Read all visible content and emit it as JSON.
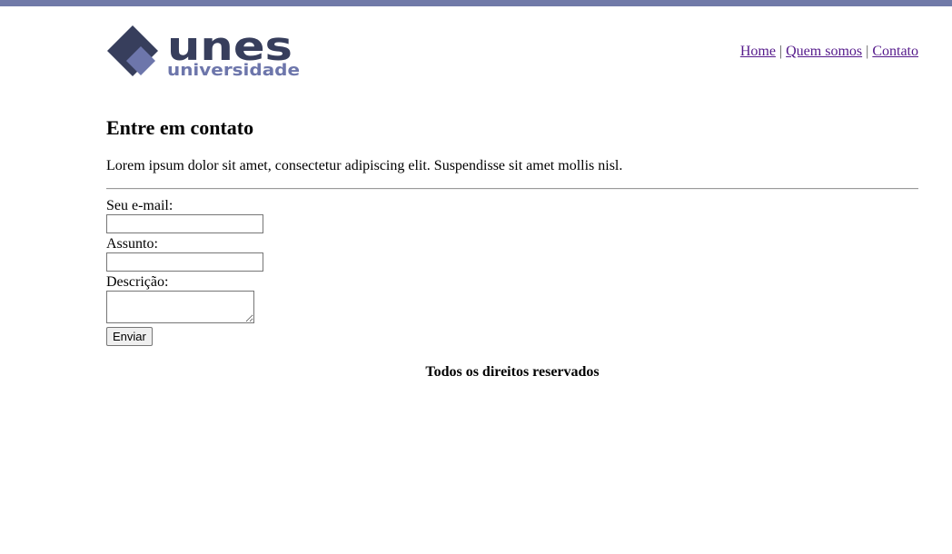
{
  "colors": {
    "top_bar": "#717aa8",
    "logo_dark": "#373e5c",
    "logo_light": "#6d76ab",
    "link": "#551a8b"
  },
  "logo": {
    "wordmark": "unes",
    "subtext": "universidade",
    "icon": "diamond-logo-icon"
  },
  "nav": {
    "items": [
      {
        "label": "Home"
      },
      {
        "label": "Quem somos"
      },
      {
        "label": "Contato"
      }
    ],
    "separator": "|"
  },
  "content": {
    "title": "Entre em contato",
    "intro": "Lorem ipsum dolor sit amet, consectetur adipiscing elit. Suspendisse sit amet mollis nisl."
  },
  "form": {
    "email_label": "Seu e-mail:",
    "email_value": "",
    "subject_label": "Assunto:",
    "subject_value": "",
    "description_label": "Descrição:",
    "description_value": "",
    "submit_label": "Enviar"
  },
  "footer": {
    "text": "Todos os direitos reservados"
  }
}
